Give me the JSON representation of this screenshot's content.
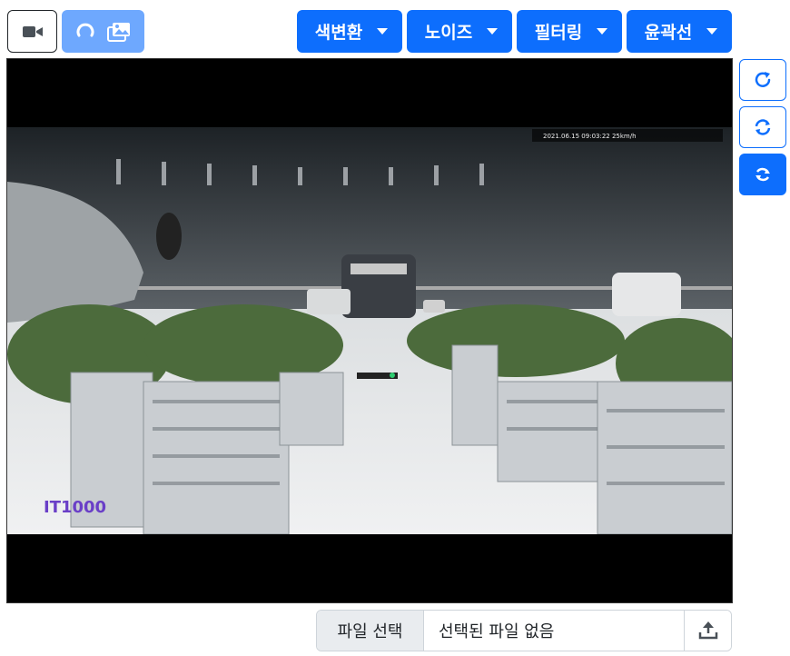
{
  "toolbar": {
    "video_icon": "video-camera-icon",
    "gallery_icon": "images-icon",
    "loading_icon": "spinner-icon"
  },
  "dropdowns": [
    {
      "label": "색변환"
    },
    {
      "label": "노이즈"
    },
    {
      "label": "필터링"
    },
    {
      "label": "윤곽선"
    }
  ],
  "side_buttons": [
    {
      "icon": "rotate-cw-icon"
    },
    {
      "icon": "refresh-icon"
    },
    {
      "icon": "flip-icon"
    }
  ],
  "image": {
    "overlay_text": "2021.06.15 09:03:22  25km/h",
    "logo_text": "IT1000"
  },
  "file_input": {
    "button_label": "파일 선택",
    "status_text": "선택된 파일 없음",
    "upload_icon": "upload-icon"
  },
  "colors": {
    "primary": "#0d6efd",
    "primary_disabled": "#6ea8fe",
    "dark": "#212529"
  }
}
